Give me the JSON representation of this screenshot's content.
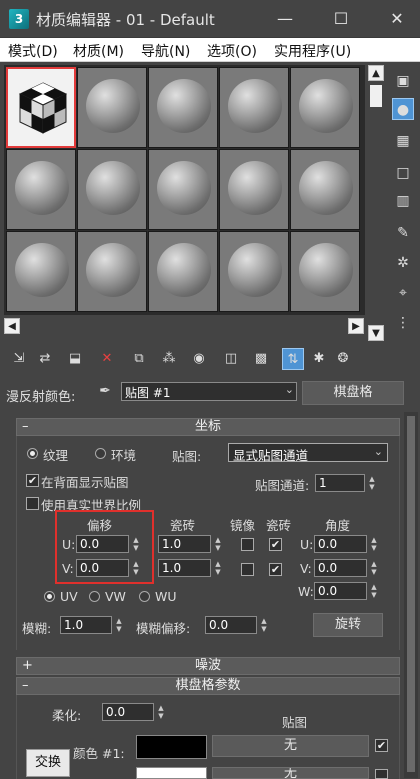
{
  "window": {
    "app_icon": "3",
    "title": "材质编辑器 - 01 - Default",
    "minimize": "—",
    "maximize": "☐",
    "close": "✕"
  },
  "menu": [
    "模式(D)",
    "材质(M)",
    "导航(N)",
    "选项(O)",
    "实用程序(U)"
  ],
  "slots": {
    "rows": 3,
    "cols": 5,
    "active_index": 0
  },
  "material": {
    "name_label": "漫反射颜色:",
    "name_value": "贴图 #1",
    "type_button": "棋盘格"
  },
  "coordinates": {
    "header": "坐标",
    "header_sign": "–",
    "radio_texture": "纹理",
    "radio_environment": "环境",
    "mapping_label": "贴图:",
    "mapping_value": "显式贴图通道",
    "show_back": "在背面显示贴图",
    "show_back_checked": true,
    "use_real_world": "使用真实世界比例",
    "use_real_world_checked": false,
    "map_channel_label": "贴图通道:",
    "map_channel_value": "1",
    "col_offset": "偏移",
    "col_tiling": "瓷砖",
    "col_mirror": "镜像",
    "col_tile": "瓷砖",
    "col_angle": "角度",
    "u_label": "U:",
    "v_label": "V:",
    "w_label": "W:",
    "u_offset": "0.0",
    "v_offset": "0.0",
    "u_tiling": "1.0",
    "v_tiling": "1.0",
    "u_angle": "0.0",
    "v_angle": "0.0",
    "w_angle": "0.0",
    "uv": "UV",
    "vw": "VW",
    "wu": "WU",
    "blur_label": "模糊:",
    "blur_value": "1.0",
    "blur_offset_label": "模糊偏移:",
    "blur_offset_value": "0.0",
    "rotate_button": "旋转"
  },
  "noise": {
    "header": "噪波",
    "header_sign": "+"
  },
  "checker": {
    "header": "棋盘格参数",
    "header_sign": "–",
    "soften_label": "柔化:",
    "soften_value": "0.0",
    "maps_label": "贴图",
    "color1_label": "颜色 #1:",
    "color1_hex": "#000000",
    "color2_hex": "#ffffff",
    "map1_button": "无",
    "map2_button": "无",
    "swap_button": "交换"
  }
}
